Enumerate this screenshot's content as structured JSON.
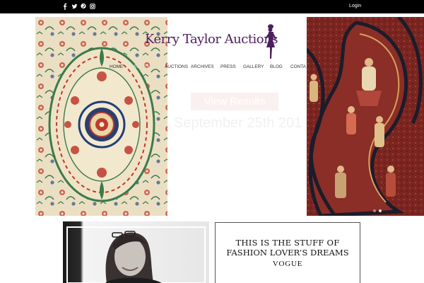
{
  "social": {
    "icons": [
      "facebook-icon",
      "twitter-icon",
      "pinterest-icon",
      "instagram-icon"
    ],
    "glyphs": [
      "f",
      "",
      "p",
      ""
    ]
  },
  "header": {
    "login_label": "Login"
  },
  "brand": {
    "name": "Kerry Taylor Auctions",
    "color": "#4c1f5e"
  },
  "nav": {
    "items": [
      "HOME",
      "ABOUT US",
      "AUCTIONS",
      "ARCHIVES",
      "PRESS",
      "GALLERY",
      "BLOG",
      "CONTA"
    ]
  },
  "hero": {
    "button_label": "View Results",
    "date_text": "September 25th 201"
  },
  "slider": {
    "slides": 2,
    "active": 1
  },
  "quote": {
    "line1": "THIS IS THE STUFF OF",
    "line2": "FASHION LOVER’S DREAMS",
    "source": "VOGUE"
  },
  "colors": {
    "topbar": "#000000",
    "carpet_left_bg": "#e9dcc0",
    "carpet_right_bg": "#7a2420"
  }
}
